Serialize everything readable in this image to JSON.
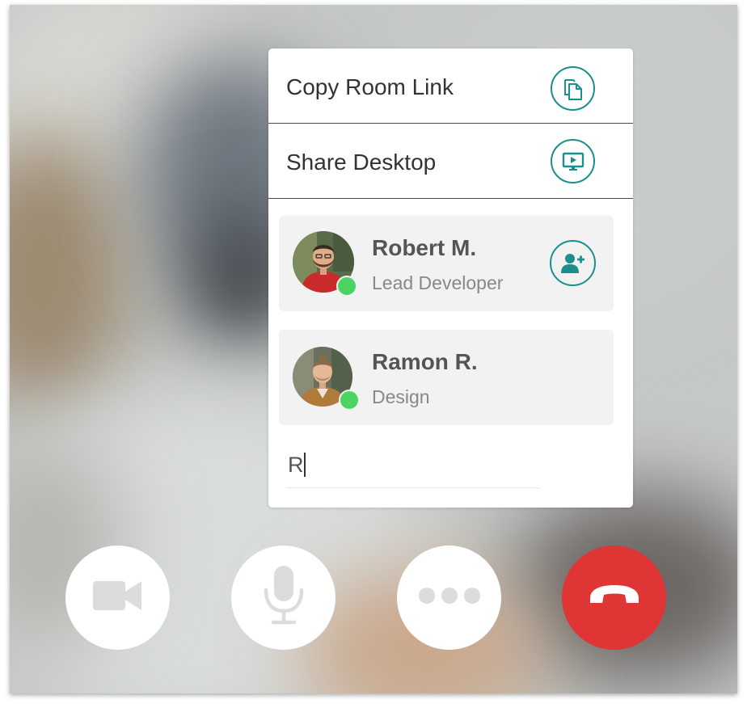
{
  "menu": {
    "copy_room_link": {
      "label": "Copy Room Link",
      "icon": "copy-icon"
    },
    "share_desktop": {
      "label": "Share Desktop",
      "icon": "screen-share-icon"
    }
  },
  "participants": [
    {
      "name": "Robert M.",
      "role": "Lead Developer",
      "status": "online",
      "action_icon": "add-user-icon"
    },
    {
      "name": "Ramon R.",
      "role": "Design",
      "status": "online"
    }
  ],
  "search": {
    "value": "R"
  },
  "controls": [
    {
      "name": "camera",
      "icon": "video-camera-icon"
    },
    {
      "name": "microphone",
      "icon": "microphone-icon"
    },
    {
      "name": "more",
      "icon": "more-dots-icon"
    },
    {
      "name": "hang-up",
      "icon": "phone-hangup-icon"
    }
  ],
  "colors": {
    "accent": "#1a8f8d",
    "online": "#4cd463",
    "hangup": "#e03535",
    "card_bg": "#f2f2f2"
  }
}
